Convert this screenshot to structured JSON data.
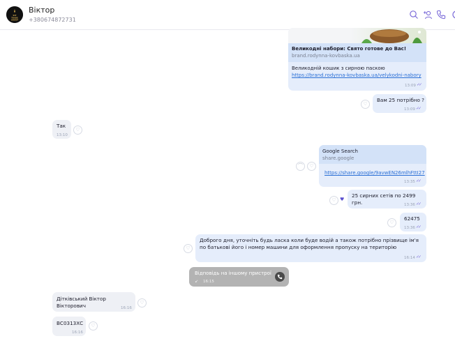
{
  "contact": {
    "name": "Віктор",
    "phone": "+380674872731",
    "avatar_text": "SIT TRADE GROUP"
  },
  "messages": [
    {
      "kind": "link_card",
      "dir": "out",
      "title": "Великодні набори: Свято готове до Вас!",
      "domain": "brand.rodynna-kovbaska.ua",
      "text": "Великодній кошик з сирною паскою",
      "url": "https://brand.rodynna-kovbaska.ua/velykodni-nabory",
      "time": "13:09"
    },
    {
      "kind": "text",
      "dir": "out",
      "text": "Вам 25 потрібно ?",
      "time": "13:09"
    },
    {
      "kind": "text",
      "dir": "in",
      "text": "Так",
      "time": "13:10"
    },
    {
      "kind": "link_card",
      "dir": "out",
      "title": "Google Search",
      "domain": "share.google",
      "url": "https://share.google/9avwEN26mlhFttI27",
      "time": "13:35"
    },
    {
      "kind": "text",
      "dir": "out",
      "text": "25 сирних сетів по 2499 грн.",
      "time": "13:36"
    },
    {
      "kind": "text",
      "dir": "out",
      "text": "62475",
      "time": "13:36"
    },
    {
      "kind": "text",
      "dir": "out",
      "text": "Доброго дня, уточніть будь ласка коли буде водій а також потрібно прізвище ім'я по батькові його і номер машини для оформлення пропуску на територію",
      "time": "16:14"
    },
    {
      "kind": "call",
      "dir": "out",
      "text": "Відповідь на іншому пристрої",
      "time": "16:15"
    },
    {
      "kind": "text",
      "dir": "in",
      "text": "Дітківський Віктор Вікторович",
      "time": "16:16"
    },
    {
      "kind": "text",
      "dir": "in",
      "text": "ВС0313ХС",
      "time": "16:16"
    }
  ],
  "colors": {
    "outgoing": "#e5edfb",
    "incoming": "#eef0f5",
    "accent": "#7c6cd9",
    "link": "#2a6fd6",
    "call": "#b3b3b3"
  },
  "icons": [
    "search-icon",
    "add-user-icon",
    "phone-icon",
    "heart-icon",
    "double-check-icon"
  ]
}
